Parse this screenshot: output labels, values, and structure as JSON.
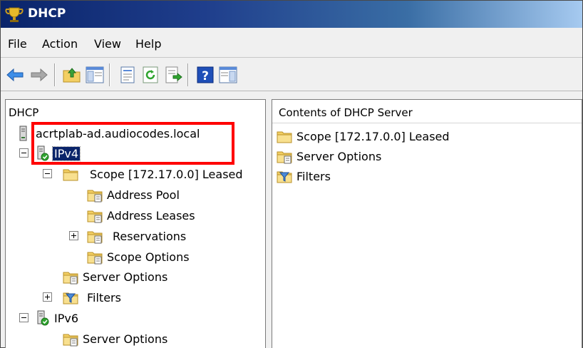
{
  "window": {
    "title": "DHCP"
  },
  "menu": {
    "items": [
      "File",
      "Action",
      "View",
      "Help"
    ]
  },
  "toolbar": {
    "buttons": [
      "back-arrow-icon",
      "forward-arrow-icon",
      "up-folder-icon",
      "show-hide-tree-icon",
      "properties-icon",
      "refresh-icon",
      "export-list-icon",
      "help-icon",
      "show-hide-action-pane-icon"
    ]
  },
  "left_pane": {
    "header": "DHCP",
    "tree": [
      {
        "label": "acrtplab-ad.audiocodes.local",
        "icon": "server-icon"
      },
      {
        "label": "IPv4",
        "icon": "ipv4-node-icon",
        "selected": true
      },
      {
        "label": "Scope [172.17.0.0] Leased",
        "icon": "scope-folder-icon"
      },
      {
        "label": "Address Pool",
        "icon": "address-pool-icon"
      },
      {
        "label": "Address Leases",
        "icon": "address-leases-icon"
      },
      {
        "label": "Reservations",
        "icon": "reservations-icon"
      },
      {
        "label": "Scope Options",
        "icon": "scope-options-icon"
      },
      {
        "label": "Server Options",
        "icon": "server-options-icon"
      },
      {
        "label": "Filters",
        "icon": "filters-icon"
      },
      {
        "label": "IPv6",
        "icon": "ipv6-node-icon"
      },
      {
        "label": "Server Options",
        "icon": "server-options-icon"
      }
    ]
  },
  "right_pane": {
    "header": "Contents of DHCP Server",
    "items": [
      {
        "label": "Scope [172.17.0.0] Leased",
        "icon": "scope-folder-icon"
      },
      {
        "label": "Server Options",
        "icon": "server-options-icon"
      },
      {
        "label": "Filters",
        "icon": "filters-icon"
      }
    ]
  },
  "colors": {
    "titlebar": "#0a246a",
    "selection": "#0a246a",
    "annotation_box": "#ff0000",
    "folder": "#f5d36a"
  }
}
